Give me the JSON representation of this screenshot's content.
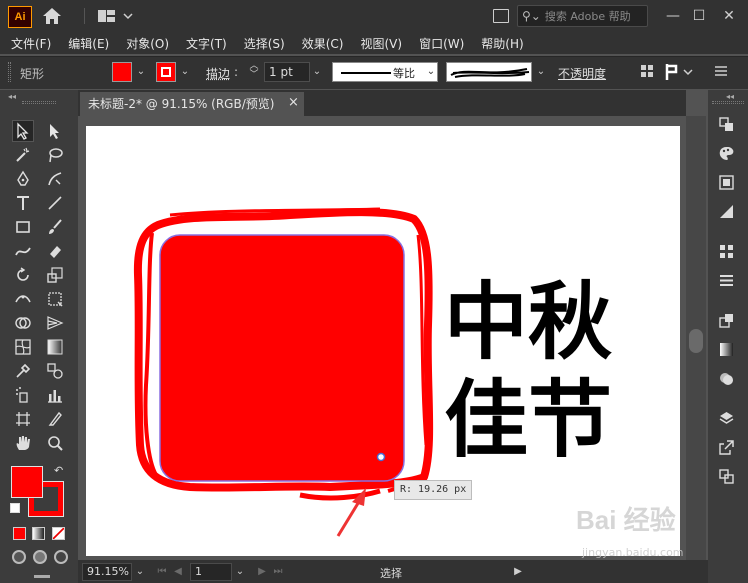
{
  "app": {
    "logo_text": "Ai",
    "search_placeholder": "搜索 Adobe 帮助"
  },
  "menu": [
    "文件(F)",
    "编辑(E)",
    "对象(O)",
    "文字(T)",
    "选择(S)",
    "效果(C)",
    "视图(V)",
    "窗口(W)",
    "帮助(H)"
  ],
  "control_bar": {
    "object_type": "矩形",
    "fill_color": "#ff0000",
    "stroke_label": "描边",
    "stroke_weight": "1 pt",
    "profile_label": "等比",
    "opacity_label": "不透明度"
  },
  "document": {
    "tab_title": "未标题-2* @ 91.15% (RGB/预览)",
    "close_glyph": "×"
  },
  "artwork": {
    "line1": "中秋",
    "line2": "佳节",
    "stamp_color": "#ff0000",
    "radius_readout": "R: 19.26 px"
  },
  "status": {
    "zoom": "91.15%",
    "page": "1",
    "tool": "选择"
  },
  "watermark": {
    "brand": "Bai 经验",
    "url": "jingyan.baidu.com"
  },
  "icons": [
    "home-icon",
    "workspace-icon",
    "arrange-documents-icon",
    "search-icon",
    "minimize-icon",
    "maximize-icon",
    "close-icon"
  ]
}
